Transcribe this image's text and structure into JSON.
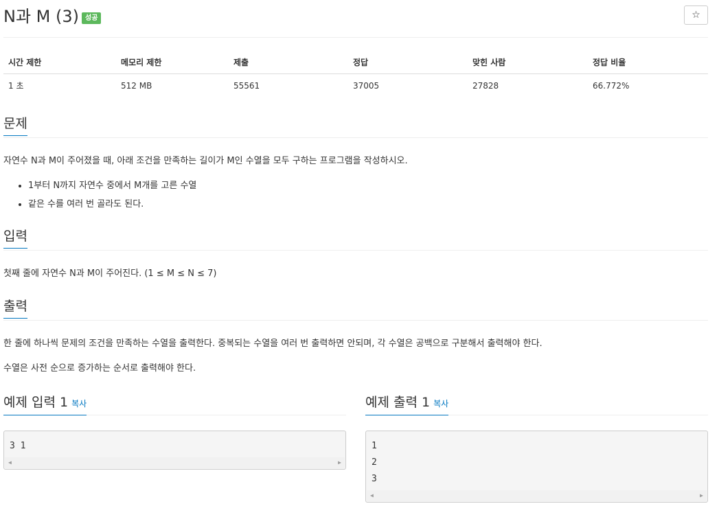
{
  "problem": {
    "title": "N과 M (3)",
    "badge": "성공",
    "star_icon": "☆"
  },
  "stats": {
    "headers": [
      "시간 제한",
      "메모리 제한",
      "제출",
      "정답",
      "맞힌 사람",
      "정답 비율"
    ],
    "values": [
      "1 초",
      "512 MB",
      "55561",
      "37005",
      "27828",
      "66.772%"
    ]
  },
  "description": {
    "heading": "문제",
    "text": "자연수 N과 M이 주어졌을 때, 아래 조건을 만족하는 길이가 M인 수열을 모두 구하는 프로그램을 작성하시오.",
    "bullets": [
      "1부터 N까지 자연수 중에서 M개를 고른 수열",
      "같은 수를 여러 번 골라도 된다."
    ]
  },
  "input": {
    "heading": "입력",
    "text": "첫째 줄에 자연수 N과 M이 주어진다. (1 ≤ M ≤ N ≤ 7)"
  },
  "output": {
    "heading": "출력",
    "text1": "한 줄에 하나씩 문제의 조건을 만족하는 수열을 출력한다. 중복되는 수열을 여러 번 출력하면 안되며, 각 수열은 공백으로 구분해서 출력해야 한다.",
    "text2": "수열은 사전 순으로 증가하는 순서로 출력해야 한다."
  },
  "samples": {
    "input_title": "예제 입력 1",
    "output_title": "예제 출력 1",
    "copy_label": "복사",
    "input_lines": [
      "3 1"
    ],
    "output_lines": [
      "1",
      "2",
      "3"
    ],
    "scroll_left": "◀",
    "scroll_right": "▶"
  },
  "colors": {
    "accent": "#0076c0",
    "success": "#5cb85c"
  }
}
